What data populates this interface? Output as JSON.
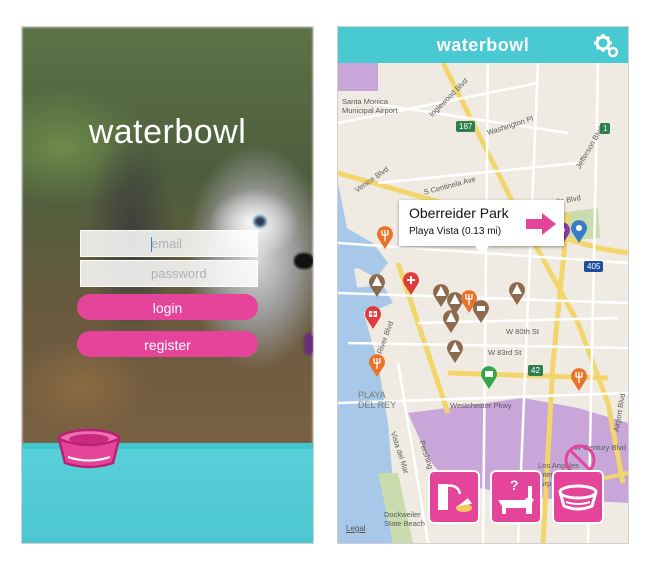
{
  "login_screen": {
    "app_name": "waterbowl",
    "email_placeholder": "email",
    "password_placeholder": "password",
    "login_label": "login",
    "register_label": "register",
    "colors": {
      "accent": "#e4449a",
      "water": "#4cc7d1"
    }
  },
  "map_screen": {
    "title": "waterbowl",
    "settings_icon": "gear-icon",
    "popup": {
      "place": "Oberreider Park",
      "detail": "Playa Vista (0.13 mi)",
      "action_icon": "arrow-right-icon"
    },
    "map_labels": {
      "airport_santa_monica": "Santa Monica\nMunicipal Airport",
      "inglewood": "Inglewood Blvd",
      "washington": "Washington Pl",
      "jefferson": "Jefferson Blvd",
      "venice": "Venice Blvd",
      "centinela": "S Centinela Ave",
      "sawtelle": "Sawtelle Blvd",
      "w_80th": "W 80th St",
      "w_83rd": "W 83rd St",
      "westchester": "Westchester Pkwy",
      "playa_del_rey": "PLAYA\nDEL REY",
      "w_century": "W Century Blvd",
      "lax": "Los Angeles\nInternational\nAirport (LAX)",
      "dockweiler": "Dockweiler\nState Beach",
      "vista": "Vista del Mar",
      "pershing": "Pershing Dr",
      "airport_blvd": "Airport Blvd",
      "river": "River Blvd"
    },
    "shields": {
      "s187": "187",
      "s42": "42",
      "s405": "405",
      "s1": "1"
    },
    "bottom_buttons": [
      "dog-fountain-icon",
      "dog-question-icon",
      "water-bowl-icon"
    ],
    "legal": "Legal",
    "colors": {
      "header": "#49c9d2",
      "pin_park": "#8b6a4e",
      "pin_food": "#e8742c",
      "pin_vet": "#e03c3c",
      "pin_grooming": "#8a3aa0",
      "pin_store": "#33a84a"
    }
  }
}
